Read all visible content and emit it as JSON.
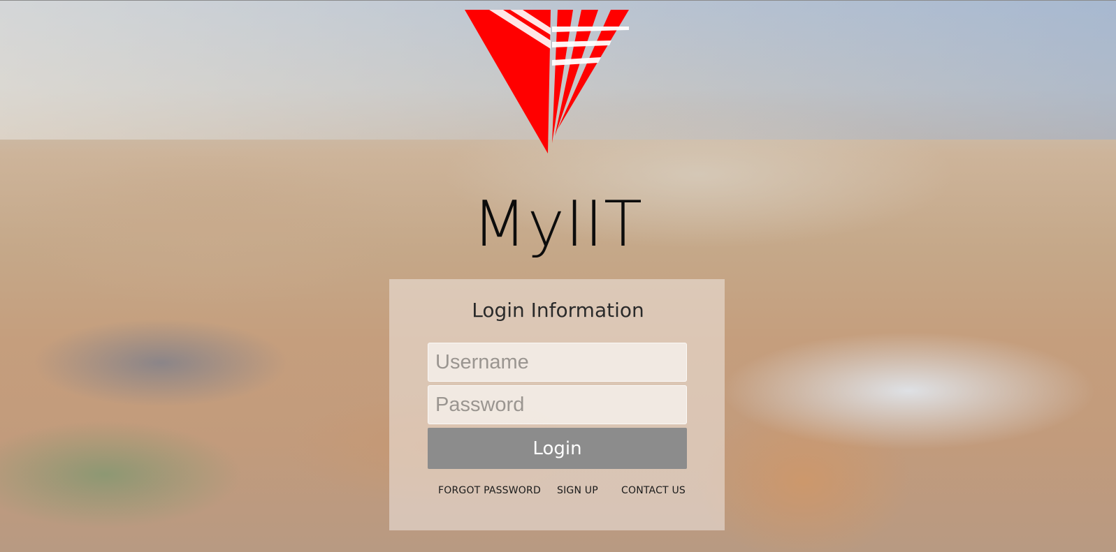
{
  "brand": {
    "app_name": "MyIIT",
    "logo_color": "#ff0000",
    "logo_icon": "iit-triangle-logo"
  },
  "login_panel": {
    "title": "Login Information",
    "username_placeholder": "Username",
    "password_placeholder": "Password",
    "login_label": "Login"
  },
  "links": {
    "forgot_password": "FORGOT PASSWORD",
    "sign_up": "SIGN UP",
    "contact_us": "CONTACT US"
  },
  "colors": {
    "button_bg": "#8c8c8c",
    "panel_bg": "rgba(238,232,226,0.55)"
  }
}
